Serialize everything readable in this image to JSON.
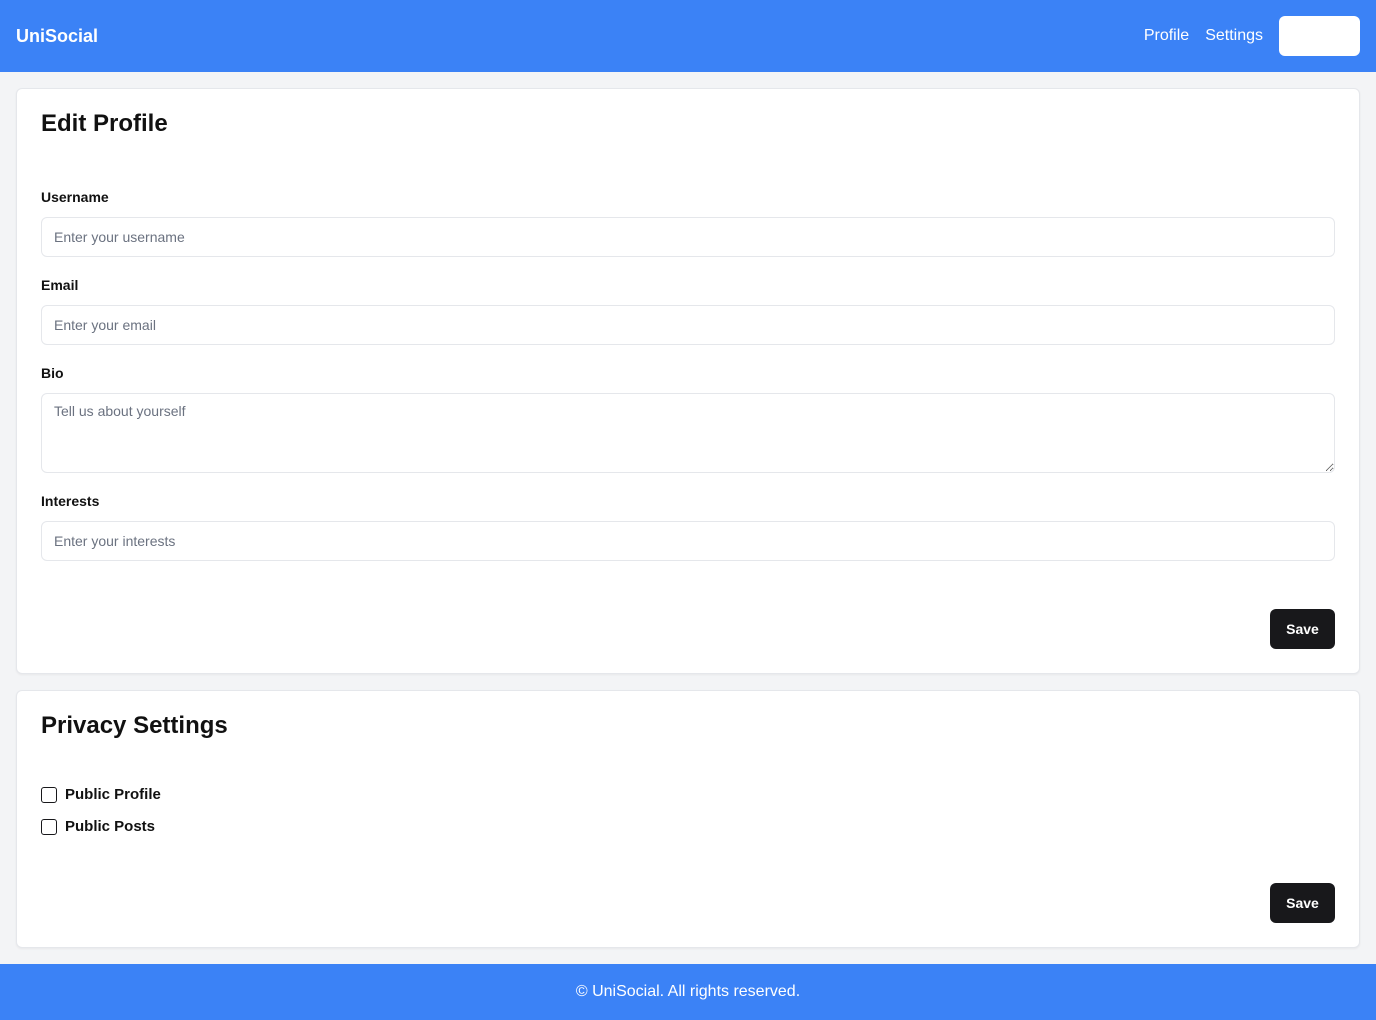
{
  "header": {
    "brand": "UniSocial",
    "nav": {
      "profile_label": "Profile",
      "settings_label": "Settings",
      "button_label": ""
    }
  },
  "edit_profile": {
    "title": "Edit Profile",
    "username": {
      "label": "Username",
      "placeholder": "Enter your username",
      "value": ""
    },
    "email": {
      "label": "Email",
      "placeholder": "Enter your email",
      "value": ""
    },
    "bio": {
      "label": "Bio",
      "placeholder": "Tell us about yourself",
      "value": ""
    },
    "interests": {
      "label": "Interests",
      "placeholder": "Enter your interests",
      "value": ""
    },
    "save_label": "Save"
  },
  "privacy": {
    "title": "Privacy Settings",
    "options": [
      {
        "label": "Public Profile",
        "checked": false
      },
      {
        "label": "Public Posts",
        "checked": false
      }
    ],
    "save_label": "Save"
  },
  "footer": {
    "text": "© UniSocial. All rights reserved."
  },
  "colors": {
    "accent": "#3b82f6",
    "button_dark": "#18181b",
    "page_bg": "#f3f4f6"
  }
}
